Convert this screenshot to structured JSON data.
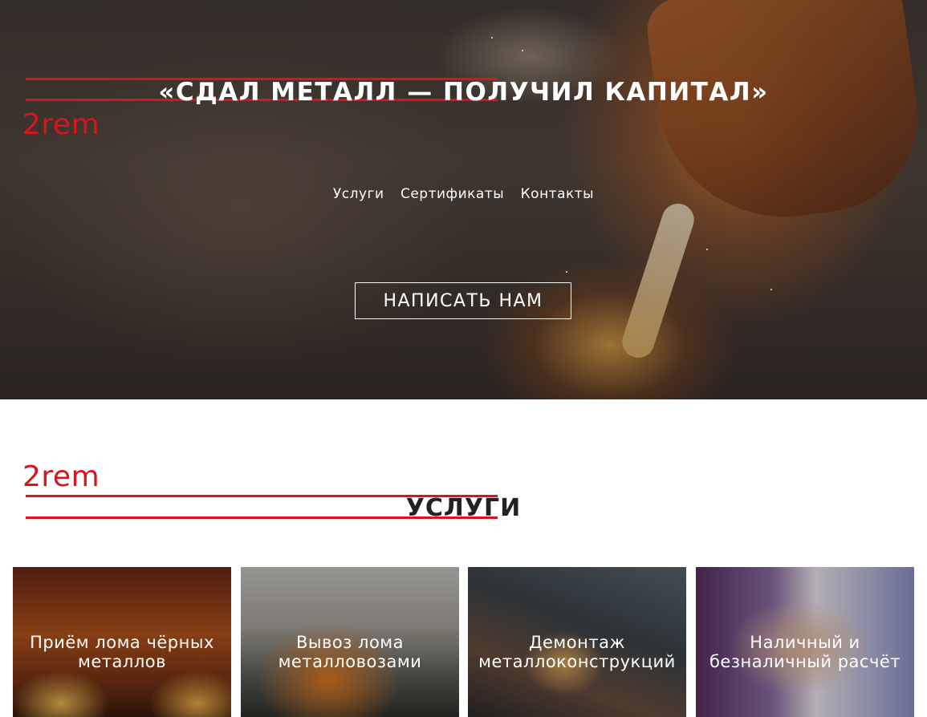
{
  "hero": {
    "title": "«СДАЛ МЕТАЛЛ — ПОЛУЧИЛ КАПИТАЛ»",
    "logo": "2rem",
    "nav": [
      {
        "label": "Услуги"
      },
      {
        "label": "Сертификаты"
      },
      {
        "label": "Контакты"
      }
    ],
    "cta_label": "НАПИСАТЬ НАМ"
  },
  "services": {
    "logo": "2rem",
    "title": "УСЛУГИ",
    "cards": [
      {
        "label": "Приём лома чёрных металлов"
      },
      {
        "label": "Вывоз лома металловозами"
      },
      {
        "label": "Демонтаж металлоконструкций"
      },
      {
        "label": "Наличный и безналичный расчёт"
      }
    ]
  },
  "colors": {
    "accent": "#d9141c",
    "text_light": "#ffffff",
    "text_dark": "#222222"
  }
}
